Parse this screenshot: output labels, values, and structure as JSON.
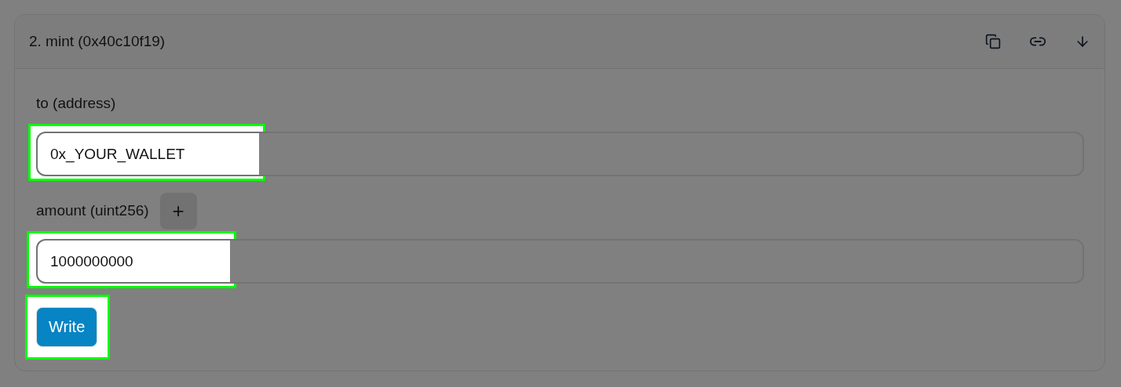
{
  "card": {
    "title": "2. mint (0x40c10f19)",
    "expanded": true
  },
  "inputs": [
    {
      "label": "to (address)",
      "value": "0x_YOUR_WALLET",
      "highlighted": true,
      "has_add_button": false
    },
    {
      "label": "amount (uint256)",
      "value": "1000000000",
      "highlighted": true,
      "has_add_button": true,
      "add_label": "+"
    }
  ],
  "write_button": {
    "label": "Write",
    "highlighted": true
  }
}
